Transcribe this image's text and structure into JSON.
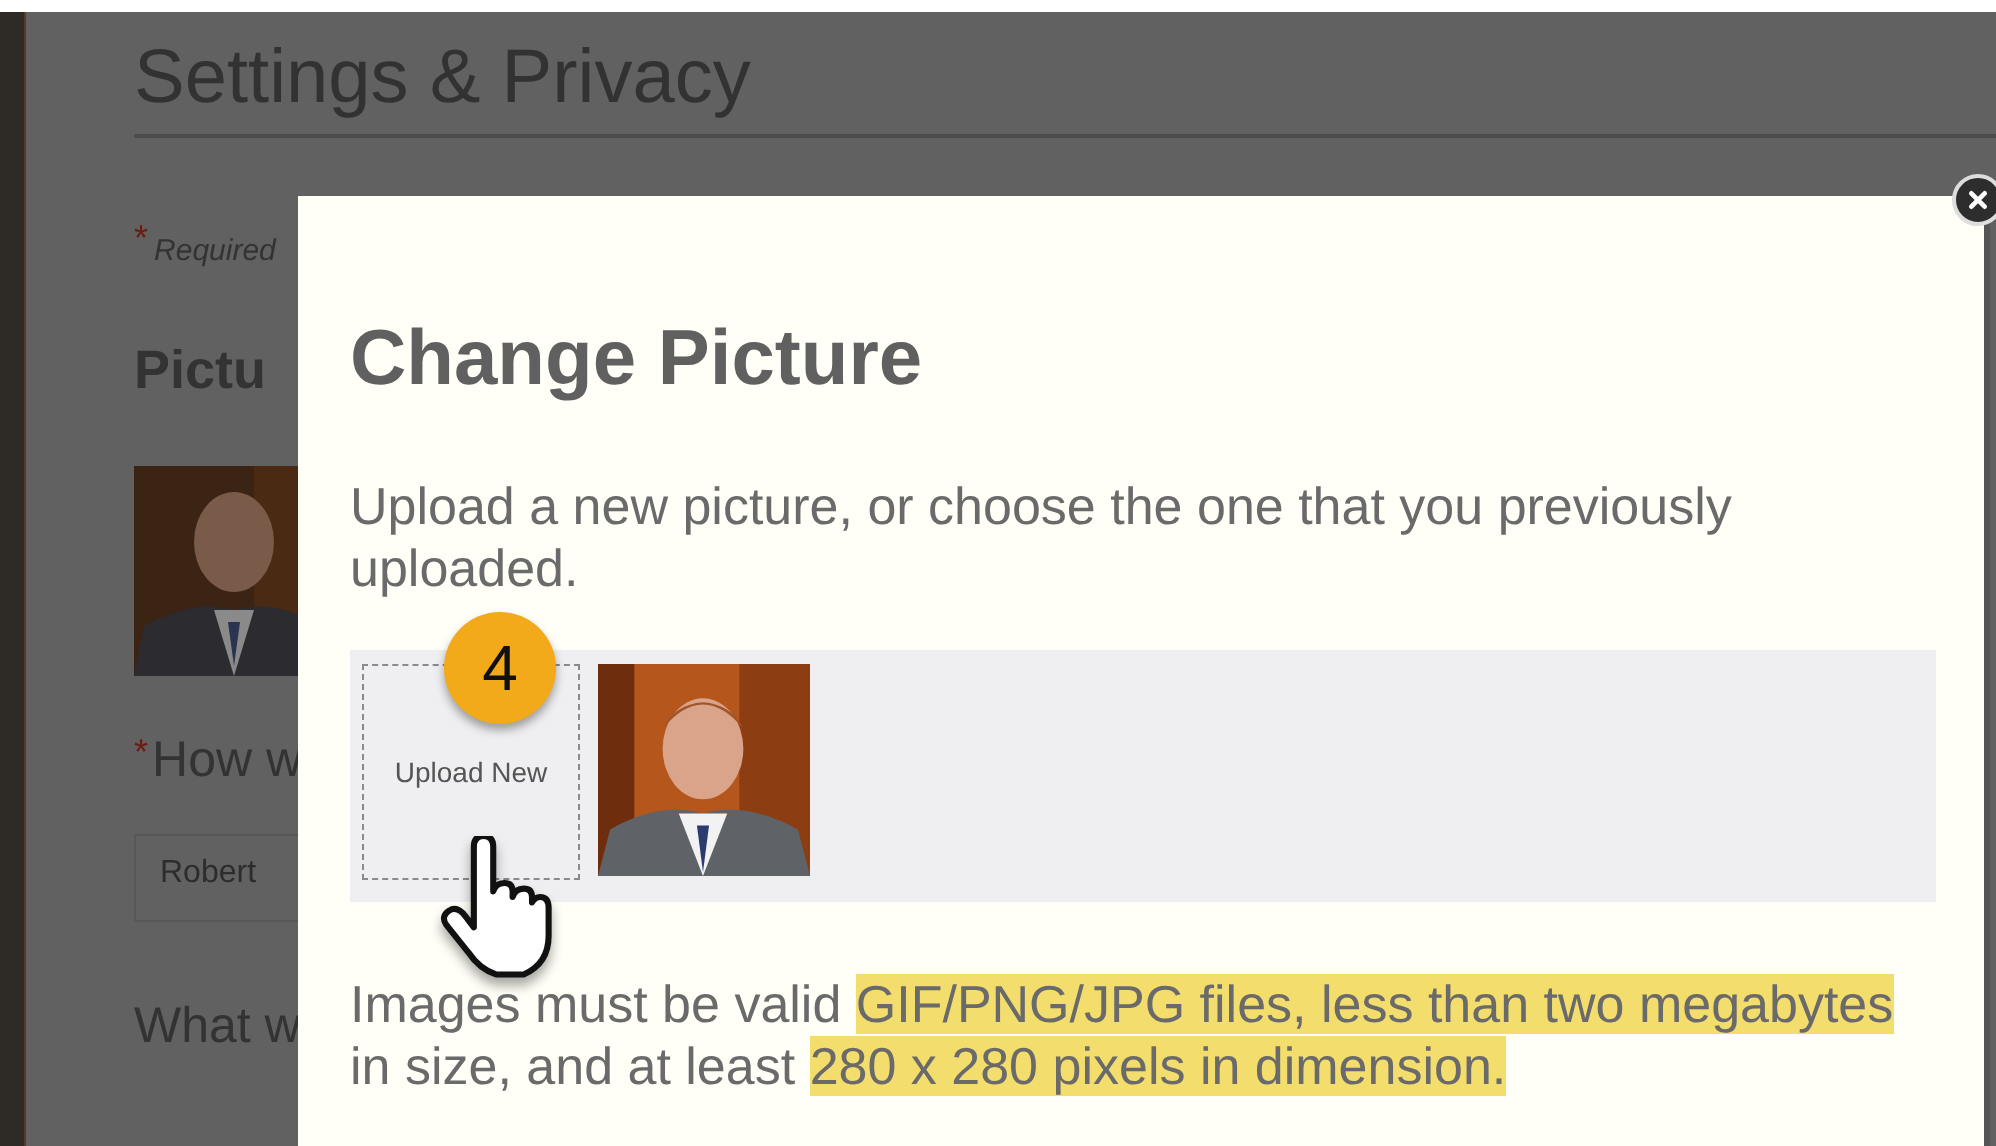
{
  "page": {
    "title": "Settings & Privacy",
    "required_marker": "*",
    "required_note": "Required",
    "section_heading": "Pictu",
    "question_marker": "*",
    "name_question": "How w",
    "first_name_value": "Robert",
    "next_question": "What w"
  },
  "dialog": {
    "title": "Change Picture",
    "intro": "Upload a new picture, or choose the one that you previously uploaded.",
    "upload_button": "Upload New",
    "step_badge": "4",
    "requirements": [
      {
        "text": "Images must be valid ",
        "highlighted": false
      },
      {
        "text": "GIF/PNG/JPG files, less than two megabytes",
        "highlighted": true
      },
      {
        "text": " in size, and at least ",
        "highlighted": false
      },
      {
        "text": "280 x 280 pixels in dimension.",
        "highlighted": true
      }
    ]
  }
}
